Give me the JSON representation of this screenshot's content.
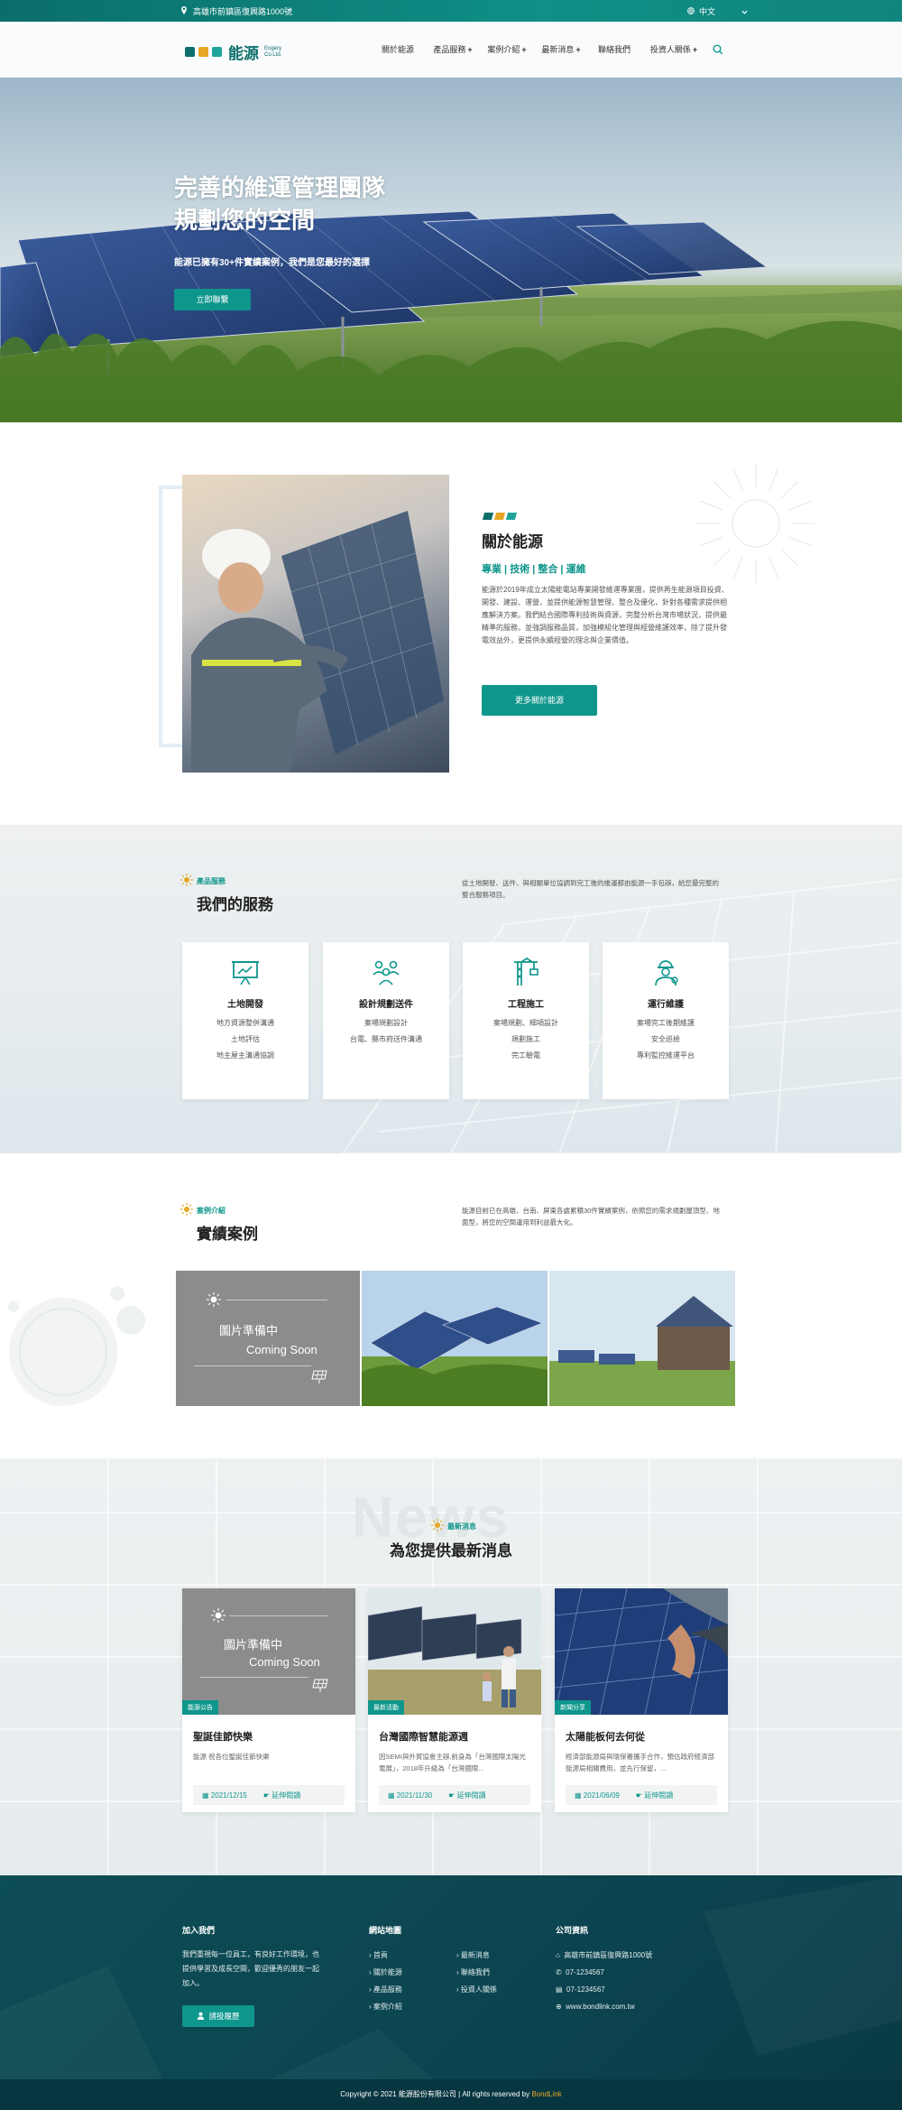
{
  "topbar": {
    "address": "高雄市前鎮區復興路1000號",
    "language": "中文"
  },
  "logo": {
    "name": "能源",
    "sub_line1": "Engery",
    "sub_line2": "Co.Ltd."
  },
  "nav": [
    {
      "label": "關於能源",
      "plus": ""
    },
    {
      "label": "產品服務",
      "plus": "+"
    },
    {
      "label": "案例介紹",
      "plus": "+"
    },
    {
      "label": "最新消息",
      "plus": "+"
    },
    {
      "label": "聯絡我們",
      "plus": ""
    },
    {
      "label": "投資人關係",
      "plus": "+"
    }
  ],
  "hero": {
    "title_line1": "完善的維運管理團隊",
    "title_line2": "規劃您的空間",
    "subtitle": "能源已擁有30+件實績案例，我們是您最好的選擇",
    "cta": "立即聯繫"
  },
  "about": {
    "title": "關於能源",
    "tagline": "專業 | 技術 | 整合 | 運維",
    "body": "能源於2019年成立太陽能電站專業開發維運專業團，提供再生能源項目投資、開發、建設、運營，並提供能源智慧管理、整合及優化，針對各種需求提供相應解決方案。我們結合國際專利技術與資源，完整分析台灣市場狀況，提供最精準的服務，並強調服務品質，加強模組化管理與經營維護效率，除了提升發電效益外，更提供永續經營的理念與企業價值。",
    "button": "更多關於能源"
  },
  "services": {
    "tag": "產品服務",
    "title": "我們的服務",
    "intro": "從土地開發、送件、與相關單位協調到完工後的維運都由能源一手包辦，給您最完整的整合服務項目。",
    "cards": [
      {
        "icon": "presentation-board-icon",
        "title": "土地開發",
        "lines": [
          "地方資源整併溝通",
          "土地評估",
          "地主屋主溝通協調"
        ]
      },
      {
        "icon": "planning-team-icon",
        "title": "設計規劃送件",
        "lines": [
          "案場規劃設計",
          "台電、縣市府送件溝通"
        ]
      },
      {
        "icon": "construction-crane-icon",
        "title": "工程施工",
        "lines": [
          "案場規劃、細項設計",
          "規劃施工",
          "完工驗電"
        ]
      },
      {
        "icon": "maintenance-worker-icon",
        "title": "運行維護",
        "lines": [
          "案場完工後期維護",
          "安全巡檢",
          "專利監控維運平台"
        ]
      }
    ]
  },
  "cases": {
    "tag": "案例介紹",
    "title": "實績案例",
    "intro": "能源目前已在高雄、台南、屏東各處累積30件實績案例，依照您的需求規劃屋頂型、地面型，將您的空間運用到利益最大化。",
    "placeholder_cn": "圖片準備中",
    "placeholder_en": "Coming Soon"
  },
  "news": {
    "tag": "最新消息",
    "title": "為您提供最新消息",
    "bg_word": "News",
    "items": [
      {
        "badge": "能源公告",
        "title": "聖誕佳節快樂",
        "desc": "能源 祝各位聖誕佳節快樂",
        "date": "2021/12/15",
        "more": "延伸閱讀",
        "placeholder_cn": "圖片準備中",
        "placeholder_en": "Coming Soon"
      },
      {
        "badge": "最新活動",
        "title": "台灣國際智慧能源週",
        "desc": "因SEMI與外貿協會主辦,前身為「台灣國際太陽光電展」，2018年升級為「台灣國際...",
        "date": "2021/11/30",
        "more": "延伸閱讀"
      },
      {
        "badge": "新聞分享",
        "title": "太陽能板何去何從",
        "desc": "經濟部能源局與環保署攜手合作，預估政府經濟部能源局相關費用，並先行保留，...",
        "date": "2021/06/09",
        "more": "延伸閱讀"
      }
    ]
  },
  "footer": {
    "join": {
      "title": "加入我們",
      "text": "我們重視每一位員工，有良好工作環境，也提供學習及成長空間，歡迎優秀的朋友一起加入。",
      "button": "請投履歷"
    },
    "sitemap": {
      "title": "網站地圖",
      "col1": [
        "首頁",
        "關於能源",
        "產品服務",
        "案例介紹"
      ],
      "col2": [
        "最新消息",
        "聯絡我們",
        "投資人關係"
      ]
    },
    "company": {
      "title": "公司資訊",
      "address": "高雄市前鎮區復興路1000號",
      "phone": "07-1234567",
      "fax": "07-1234567",
      "web": "www.bondlink.com.tw"
    },
    "copyright": "Copyright © 2021 能源股份有限公司 | All rights reserved by",
    "credit": "BondLink"
  },
  "colors": {
    "teal": "#0f968c",
    "dark_teal": "#0c6e6b",
    "footer": "#0b4450",
    "logo_sq1": "#0c6e6b",
    "logo_sq2": "#e6a824",
    "logo_sq3": "#1ea59a"
  }
}
